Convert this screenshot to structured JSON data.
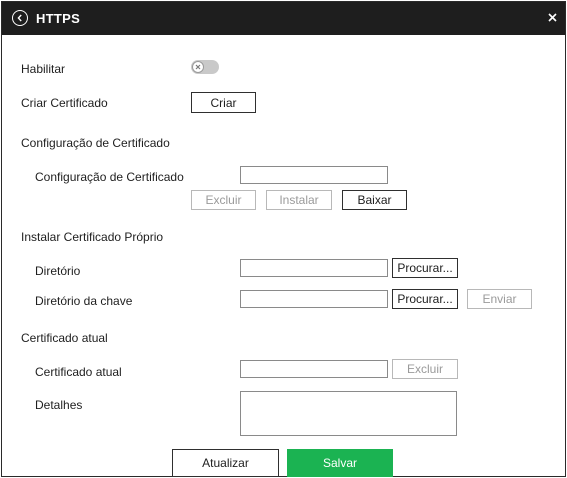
{
  "header": {
    "title": "HTTPS"
  },
  "icons": {
    "back": "chevron-left-circle-icon",
    "close": "close-icon",
    "toggle_off": "x-icon"
  },
  "colors": {
    "header_bg": "#1e1e1e",
    "save_green": "#1bb352",
    "toggle_off": "#c9c9c9",
    "disabled_text": "#9a9a9a"
  },
  "enable": {
    "label": "Habilitar",
    "state": "off"
  },
  "create_cert": {
    "label": "Criar Certificado",
    "button": "Criar"
  },
  "cert_config": {
    "section_title": "Configuração de Certificado",
    "field_label": "Configuração de Certificado",
    "field_value": "",
    "buttons": {
      "delete": "Excluir",
      "install": "Instalar",
      "download": "Baixar"
    }
  },
  "install_own": {
    "section_title": "Instalar Certificado Próprio",
    "directory_label": "Diretório",
    "directory_value": "",
    "browse": "Procurar...",
    "key_directory_label": "Diretório da chave",
    "key_directory_value": "",
    "send": "Enviar"
  },
  "current_cert": {
    "section_title": "Certificado atual",
    "field_label": "Certificado atual",
    "field_value": "",
    "delete": "Excluir",
    "details_label": "Detalhes",
    "details_value": ""
  },
  "footer": {
    "update": "Atualizar",
    "save": "Salvar"
  }
}
